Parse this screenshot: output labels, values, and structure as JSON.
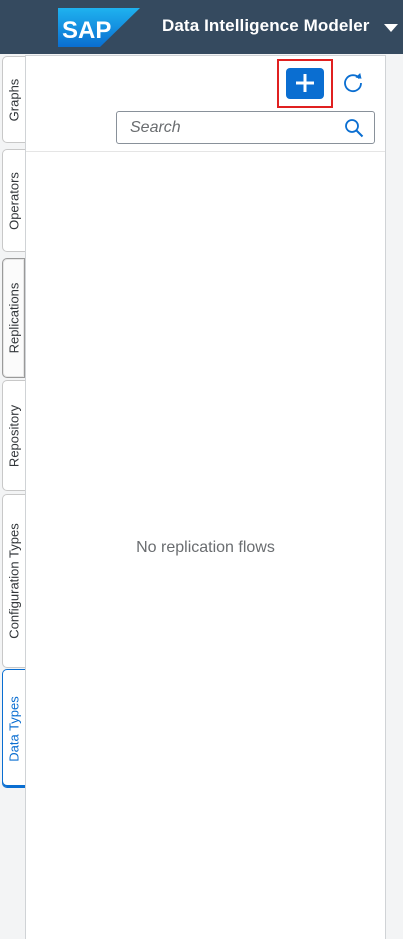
{
  "header": {
    "logo_text": "SAP",
    "title": "Data Intelligence Modeler"
  },
  "tabs": [
    {
      "label": "Graphs"
    },
    {
      "label": "Operators"
    },
    {
      "label": "Replications"
    },
    {
      "label": "Repository"
    },
    {
      "label": "Configuration Types"
    },
    {
      "label": "Data Types"
    }
  ],
  "toolbar": {
    "add_icon": "plus-icon",
    "refresh_icon": "refresh-icon"
  },
  "search": {
    "placeholder": "Search",
    "value": "",
    "icon": "search-icon"
  },
  "content": {
    "empty_message": "No replication flows"
  },
  "colors": {
    "header_bg": "#354a5f",
    "accent": "#0a6ed1",
    "highlight_frame": "#e02020"
  }
}
